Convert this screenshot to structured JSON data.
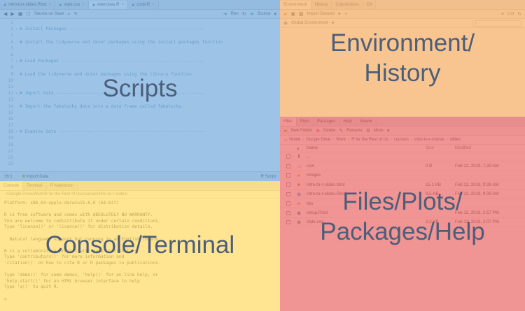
{
  "overlays": {
    "scripts": "Scripts",
    "environment": [
      "Environment/",
      "History"
    ],
    "console": "Console/Terminal",
    "files": [
      "Files/Plots/",
      "Packages/Help"
    ]
  },
  "overlay_colors": {
    "scripts": "#6fa8dc",
    "environment": "#f6b26b",
    "console": "#ffd966",
    "files": "#ea6b6b"
  },
  "editor": {
    "tabs": [
      {
        "label": "intro-to-r-slides.Rmd",
        "icon": "rmd-icon"
      },
      {
        "label": "style.css",
        "icon": "css-icon"
      },
      {
        "label": "exercises.R",
        "icon": "r-file-icon"
      },
      {
        "label": "code.R",
        "icon": "r-file-icon"
      }
    ],
    "toolbar": {
      "source_on_save": "Source on Save",
      "run": "Run",
      "source": "Source"
    },
    "lines": [
      {
        "n": "1",
        "fold": "",
        "text": ""
      },
      {
        "n": "2",
        "fold": "▾",
        "text": "# Install Packages ----------------------------------------------------"
      },
      {
        "n": "3",
        "fold": "",
        "text": ""
      },
      {
        "n": "4",
        "fold": "",
        "text": "# Install the tidyverse and skimr packages using the install.packages function"
      },
      {
        "n": "5",
        "fold": "",
        "text": ""
      },
      {
        "n": "6",
        "fold": "",
        "text": ""
      },
      {
        "n": "7",
        "fold": "▾",
        "text": "# Load Packages -------------------------------------------------------"
      },
      {
        "n": "8",
        "fold": "",
        "text": ""
      },
      {
        "n": "9",
        "fold": "",
        "text": "# Load the tidyverse and skimr packages using the library function"
      },
      {
        "n": "10",
        "fold": "",
        "text": ""
      },
      {
        "n": "11",
        "fold": "",
        "text": ""
      },
      {
        "n": "12",
        "fold": "▾",
        "text": "# Import Data ---------------------------------------------------------"
      },
      {
        "n": "13",
        "fold": "",
        "text": ""
      },
      {
        "n": "14",
        "fold": "",
        "text": "# Import the faketucky data into a data frame called faketucky."
      },
      {
        "n": "15",
        "fold": "",
        "text": ""
      },
      {
        "n": "16",
        "fold": "",
        "text": ""
      },
      {
        "n": "17",
        "fold": "",
        "text": ""
      },
      {
        "n": "18",
        "fold": "▾",
        "text": "# Examine Data --------------------------------------------------------"
      },
      {
        "n": "19",
        "fold": "",
        "text": ""
      },
      {
        "n": "20",
        "fold": "",
        "text": ""
      },
      {
        "n": "21",
        "fold": "",
        "text": ""
      },
      {
        "n": "22",
        "fold": "",
        "text": ""
      },
      {
        "n": "23",
        "fold": "",
        "text": ""
      }
    ],
    "status": {
      "position": "16:1",
      "section": "Import Data",
      "filetype": "R Script"
    }
  },
  "console": {
    "tabs": [
      "Console",
      "Terminal",
      "R Markdown"
    ],
    "path": "~/Google Drive/Work/R for the Rest of Us/courses/intro-to-r-slides/",
    "lines": [
      "Platform: x86_64-apple-darwin15.6.0 (64-bit)",
      "",
      "R is free software and comes with ABSOLUTELY NO WARRANTY.",
      "You are welcome to redistribute it under certain conditions.",
      "Type 'license()' or 'licence()' for distribution details.",
      "",
      "  Natural language support but running in an English locale",
      "",
      "R is a collaborative project with many contributors.",
      "Type 'contributors()' for more information and",
      "'citation()' on how to cite R or R packages in publications.",
      "",
      "Type 'demo()' for some demos, 'help()' for on-line help, or",
      "'help.start()' for an HTML browser interface to help.",
      "Type 'q()' to quit R.",
      "",
      ">"
    ]
  },
  "environment": {
    "tabs": [
      "Environment",
      "History",
      "Connections",
      "Git"
    ],
    "import_dataset": "Import Dataset",
    "list_view": "List",
    "scope": "Global Environment"
  },
  "files": {
    "tabs": [
      "Files",
      "Plots",
      "Packages",
      "Help",
      "Viewer"
    ],
    "toolbar": {
      "new_folder": "New Folder",
      "delete": "Delete",
      "rename": "Rename",
      "more": "More"
    },
    "crumbs": [
      "Home",
      "Google Drive",
      "Work",
      "R for the Rest of Us",
      "courses",
      "intro-to-r-course",
      "slides"
    ],
    "headers": {
      "name": "Name",
      "size": "Size",
      "modified": "Modified"
    },
    "rows": [
      {
        "icon": "up-arrow-icon",
        "name": "..",
        "size": "",
        "modified": ""
      },
      {
        "icon": "file-icon",
        "name": "icon",
        "size": "0 B",
        "modified": "Feb 12, 2019, 7:20 AM"
      },
      {
        "icon": "folder-icon",
        "name": "images",
        "size": "",
        "modified": ""
      },
      {
        "icon": "html-icon",
        "name": "intro-to-r-slides.html",
        "size": "15.1 KB",
        "modified": "Feb 13, 2019, 9:39 AM"
      },
      {
        "icon": "rmd-icon",
        "name": "intro-to-r-slides.Rmd",
        "size": "9.5 KB",
        "modified": "Feb 13, 2019, 9:39 AM"
      },
      {
        "icon": "folder-icon",
        "name": "libs",
        "size": "",
        "modified": ""
      },
      {
        "icon": "r-file-icon",
        "name": "setup.Rmd",
        "size": "",
        "modified": "Feb 12, 2019, 2:57 PM"
      },
      {
        "icon": "css-icon",
        "name": "style.css",
        "size": "2.3 KB",
        "modified": "Feb 12, 2019, 3:07 PM"
      }
    ]
  }
}
